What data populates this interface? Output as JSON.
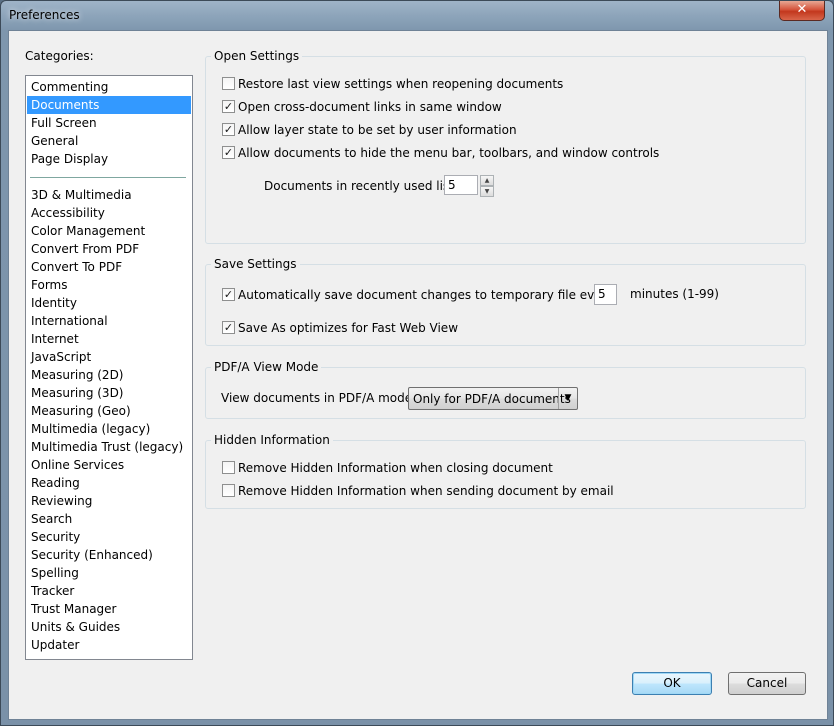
{
  "window": {
    "title": "Preferences",
    "close_glyph": "✕"
  },
  "categories": {
    "label": "Categories:",
    "items": [
      "Commenting",
      "Documents",
      "Full Screen",
      "General",
      "Page Display"
    ],
    "items2": [
      "3D & Multimedia",
      "Accessibility",
      "Color Management",
      "Convert From PDF",
      "Convert To PDF",
      "Forms",
      "Identity",
      "International",
      "Internet",
      "JavaScript",
      "Measuring (2D)",
      "Measuring (3D)",
      "Measuring (Geo)",
      "Multimedia (legacy)",
      "Multimedia Trust (legacy)",
      "Online Services",
      "Reading",
      "Reviewing",
      "Search",
      "Security",
      "Security (Enhanced)",
      "Spelling",
      "Tracker",
      "Trust Manager",
      "Units & Guides",
      "Updater"
    ],
    "selected": "Documents"
  },
  "open_settings": {
    "title": "Open Settings",
    "restore_last_view": {
      "label": "Restore last view settings when reopening documents",
      "checked": false
    },
    "cross_doc_links": {
      "label": "Open cross-document links in same window",
      "checked": true
    },
    "layer_state": {
      "label": "Allow layer state to be set by user information",
      "checked": true
    },
    "hide_menu": {
      "label": "Allow documents to hide the menu bar, toolbars, and window controls",
      "checked": true
    },
    "recent_list_label": "Documents in recently used list:",
    "recent_list_value": "5"
  },
  "save_settings": {
    "title": "Save Settings",
    "autosave": {
      "label": "Automatically save document changes to temporary file every:",
      "checked": true
    },
    "autosave_minutes": "5",
    "minutes_suffix": "minutes (1-99)",
    "fast_web_view": {
      "label": "Save As optimizes for Fast Web View",
      "checked": true
    }
  },
  "pdfa": {
    "title": "PDF/A View Mode",
    "mode_label": "View documents in PDF/A mode:",
    "mode_value": "Only for PDF/A documents"
  },
  "hidden_info": {
    "title": "Hidden Information",
    "on_close": {
      "label": "Remove Hidden Information when closing document",
      "checked": false
    },
    "on_send": {
      "label": "Remove Hidden Information when sending document by email",
      "checked": false
    }
  },
  "buttons": {
    "ok": "OK",
    "cancel": "Cancel"
  },
  "glyphs": {
    "check": "✓",
    "up": "▲",
    "down": "▼",
    "dropdown": "▼"
  }
}
